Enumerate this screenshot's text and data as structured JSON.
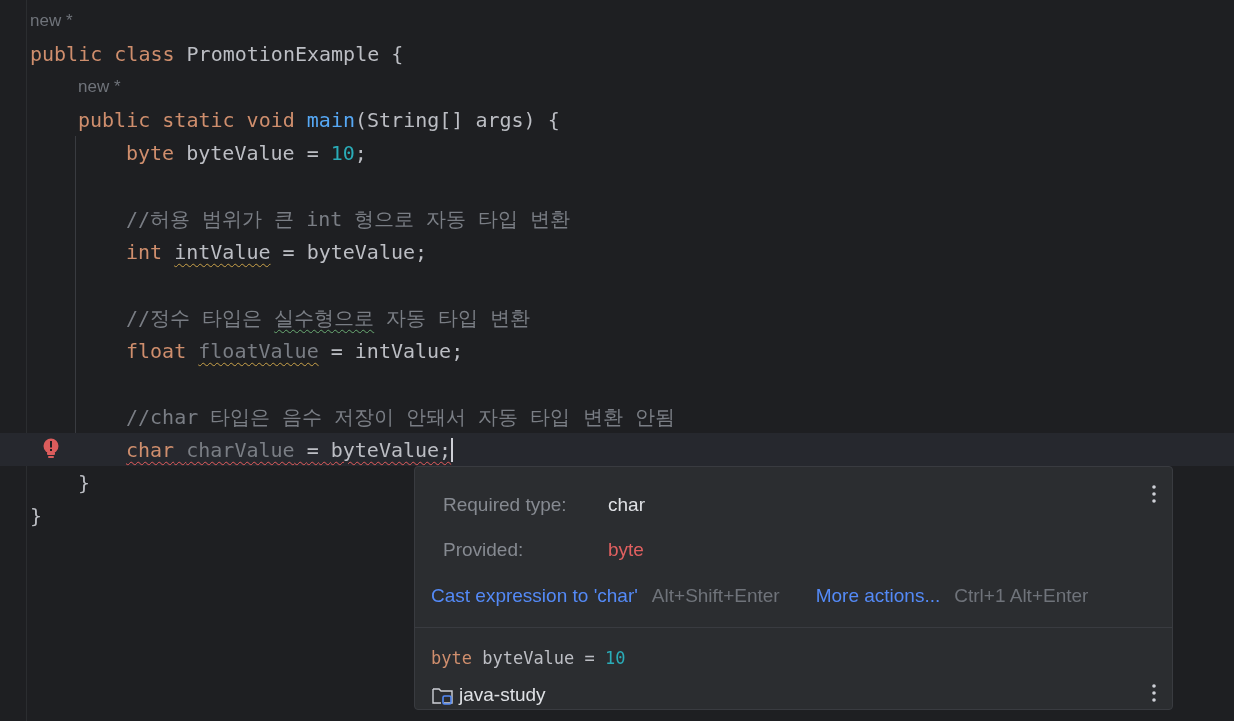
{
  "code": [
    {
      "kind": "annotation",
      "text": "new *"
    },
    {
      "kind": "line",
      "current": false,
      "tokens": [
        {
          "text": "public",
          "kind": "keyword"
        },
        {
          "text": "class",
          "kind": "keyword"
        },
        {
          "text": "PromotionExample",
          "kind": "plain"
        },
        {
          "text": "{",
          "kind": "plain"
        }
      ],
      "children": [
        {
          "kind": "annotation",
          "text": "new *"
        },
        {
          "kind": "line",
          "current": false,
          "tokens": [
            {
              "text": "public",
              "kind": "keyword"
            },
            {
              "text": "static",
              "kind": "keyword"
            },
            {
              "text": "void",
              "kind": "keyword"
            },
            {
              "text": "main",
              "kind": "method"
            },
            {
              "text": "(String[]",
              "kind": "plain",
              "attach": true
            },
            {
              "text": "args)",
              "kind": "plain"
            },
            {
              "text": "{",
              "kind": "plain"
            }
          ],
          "children": [
            {
              "kind": "line",
              "current": false,
              "tokens": [
                {
                  "text": "byte",
                  "kind": "keyword"
                },
                {
                  "text": "byteValue",
                  "kind": "plain"
                },
                {
                  "text": "=",
                  "kind": "plain"
                },
                {
                  "text": "10",
                  "kind": "number"
                },
                {
                  "text": ";",
                  "kind": "plain",
                  "attach": true
                }
              ]
            },
            {
              "kind": "blank"
            },
            {
              "kind": "line",
              "current": false,
              "tokens": [
                {
                  "text": "//허용 범위가 큰 int 형으로 자동 타입 변환",
                  "kind": "comment"
                }
              ]
            },
            {
              "kind": "line",
              "current": false,
              "tokens": [
                {
                  "text": "int",
                  "kind": "keyword"
                },
                {
                  "text": "intValue",
                  "kind": "plain",
                  "warning": true
                },
                {
                  "text": "=",
                  "kind": "plain"
                },
                {
                  "text": "byteValue;",
                  "kind": "plain"
                }
              ]
            },
            {
              "kind": "blank"
            },
            {
              "kind": "line",
              "current": false,
              "tokens": [
                {
                  "text": "//정수 타입은",
                  "kind": "comment"
                },
                {
                  "text": "실수형으로",
                  "kind": "comment",
                  "typo": true
                },
                {
                  "text": "자동 타입 변환",
                  "kind": "comment"
                }
              ]
            },
            {
              "kind": "line",
              "current": false,
              "tokens": [
                {
                  "text": "float",
                  "kind": "keyword"
                },
                {
                  "text": "floatValue",
                  "kind": "unused",
                  "warning": true
                },
                {
                  "text": "=",
                  "kind": "plain"
                },
                {
                  "text": "intValue;",
                  "kind": "plain"
                }
              ]
            },
            {
              "kind": "blank"
            },
            {
              "kind": "line",
              "current": false,
              "tokens": [
                {
                  "text": "//char 타입은 음수 저장이 안돼서 자동 타입 변환 안됨",
                  "kind": "comment"
                }
              ]
            },
            {
              "kind": "line",
              "current": true,
              "error": true,
              "tokens": [
                {
                  "text": "char",
                  "kind": "keyword"
                },
                {
                  "text": "charValue",
                  "kind": "unused"
                },
                {
                  "text": "=",
                  "kind": "plain"
                },
                {
                  "text": "byteValue;",
                  "kind": "plain"
                }
              ]
            }
          ]
        },
        {
          "kind": "line",
          "current": false,
          "tokens": [
            {
              "text": "}",
              "kind": "plain"
            }
          ]
        }
      ]
    },
    {
      "kind": "line",
      "current": false,
      "tokens": [
        {
          "text": "}",
          "kind": "plain"
        }
      ]
    }
  ],
  "popup": {
    "rows": [
      {
        "label": "Required type:",
        "value": "char",
        "kind": "normal"
      },
      {
        "label": "Provided:",
        "value": "byte",
        "kind": "error"
      }
    ],
    "actions": [
      {
        "label": "Cast expression to 'char'",
        "shortcut": "Alt+Shift+Enter"
      },
      {
        "label": "More actions...",
        "shortcut": "Ctrl+1 Alt+Enter"
      }
    ],
    "declaration": [
      {
        "text": "byte",
        "kind": "keyword"
      },
      {
        "text": "byteValue",
        "kind": "plain"
      },
      {
        "text": "=",
        "kind": "plain"
      },
      {
        "text": "10",
        "kind": "number"
      }
    ],
    "project": "java-study"
  }
}
